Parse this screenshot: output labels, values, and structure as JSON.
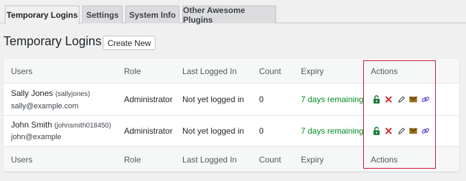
{
  "tabs": [
    {
      "label": "Temporary Logins",
      "active": true
    },
    {
      "label": "Settings",
      "active": false
    },
    {
      "label": "System Info",
      "active": false
    },
    {
      "label": "Other Awesome Plugins",
      "active": false
    }
  ],
  "header": {
    "title": "Temporary Logins",
    "create_button": "Create New"
  },
  "table": {
    "columns": [
      "Users",
      "Role",
      "Last Logged In",
      "Count",
      "Expiry",
      "Actions"
    ],
    "rows": [
      {
        "name": "Sally Jones",
        "login": "(sallyjones)",
        "email": "sally@example.com",
        "role": "Administrator",
        "last_logged_in": "Not yet logged in",
        "count": "0",
        "expiry": "7 days remaining"
      },
      {
        "name": "John Smith",
        "login": "(johnsmith018450)",
        "email": "john@example",
        "role": "Administrator",
        "last_logged_in": "Not yet logged in",
        "count": "0",
        "expiry": "7 days remaining"
      }
    ],
    "actions": [
      "lock-icon",
      "delete-icon",
      "edit-icon",
      "email-icon",
      "link-icon"
    ]
  },
  "colors": {
    "expiry_green": "#008a20",
    "lock_green": "#1e7d3a",
    "delete_red": "#d63638",
    "email_brown": "#9b6c16",
    "link_purple": "#6b5bd6",
    "highlight_red": "#c8102e"
  }
}
